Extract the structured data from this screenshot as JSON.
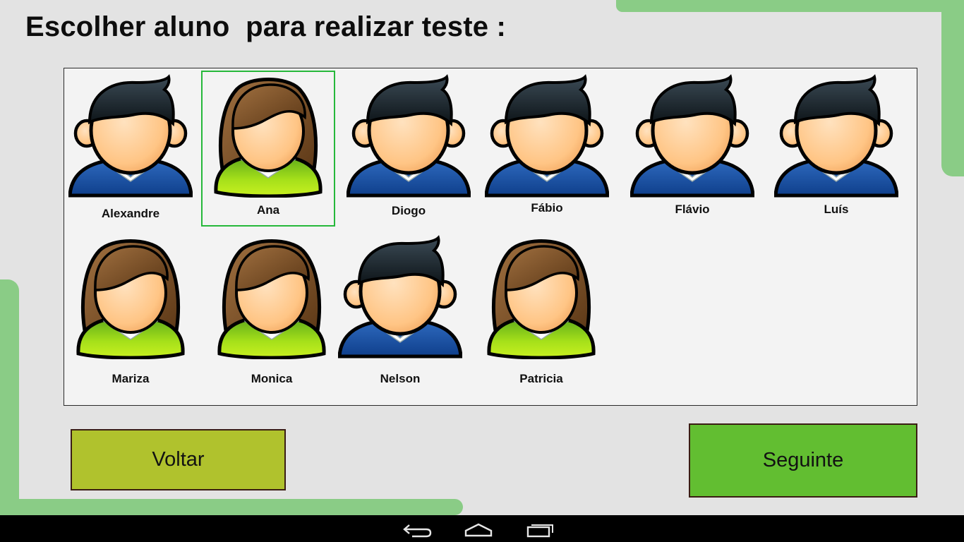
{
  "title": "Escolher aluno  para realizar teste :",
  "colors": {
    "background": "#e3e3e3",
    "accent_frame": "#8acc86",
    "panel": "#f3f3f3",
    "selection_border": "#26b83a",
    "back_button": "#b0c22d",
    "next_button": "#62be31",
    "navbar": "#000000"
  },
  "students": [
    {
      "name": "Alexandre",
      "avatar": "boy-avatar-icon",
      "selected": false
    },
    {
      "name": "Ana",
      "avatar": "girl-avatar-icon",
      "selected": true
    },
    {
      "name": "Diogo",
      "avatar": "boy-avatar-icon",
      "selected": false
    },
    {
      "name": "Fábio",
      "avatar": "boy-avatar-icon",
      "selected": false
    },
    {
      "name": "Flávio",
      "avatar": "boy-avatar-icon",
      "selected": false
    },
    {
      "name": "Luís",
      "avatar": "boy-avatar-icon",
      "selected": false
    },
    {
      "name": "Mariza",
      "avatar": "girl-avatar-icon",
      "selected": false
    },
    {
      "name": "Monica",
      "avatar": "girl-avatar-icon",
      "selected": false
    },
    {
      "name": "Nelson",
      "avatar": "boy-avatar-icon",
      "selected": false
    },
    {
      "name": "Patricia",
      "avatar": "girl-avatar-icon",
      "selected": false
    }
  ],
  "buttons": {
    "back_label": "Voltar",
    "next_label": "Seguinte"
  },
  "navbar": {
    "icons": [
      "back-icon",
      "home-icon",
      "recent-apps-icon"
    ]
  }
}
